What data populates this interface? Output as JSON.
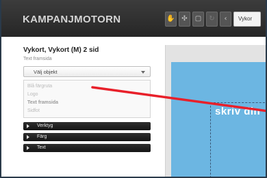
{
  "app": {
    "logo": "KAMPANJMOTORN"
  },
  "toolbar": {
    "icons": [
      "hand-icon",
      "move-icon",
      "fit-icon",
      "redo-icon",
      "back-icon"
    ],
    "select_value": "Vykor"
  },
  "panel": {
    "title": "Vykort, Vykort (M) 2 sid",
    "subtitle": "Text framsida",
    "dropdown_label": "Välj objekt",
    "options": [
      "Blå färgruta",
      "Logo",
      "Text framsida",
      "Sidfot"
    ],
    "selected_option": "Text framsida",
    "accordion": [
      "Verktyg",
      "Färg",
      "Text"
    ]
  },
  "canvas": {
    "visible_text": "skriv din",
    "card_color": "#6cb6e2",
    "annotation_color": "#e8202a"
  }
}
